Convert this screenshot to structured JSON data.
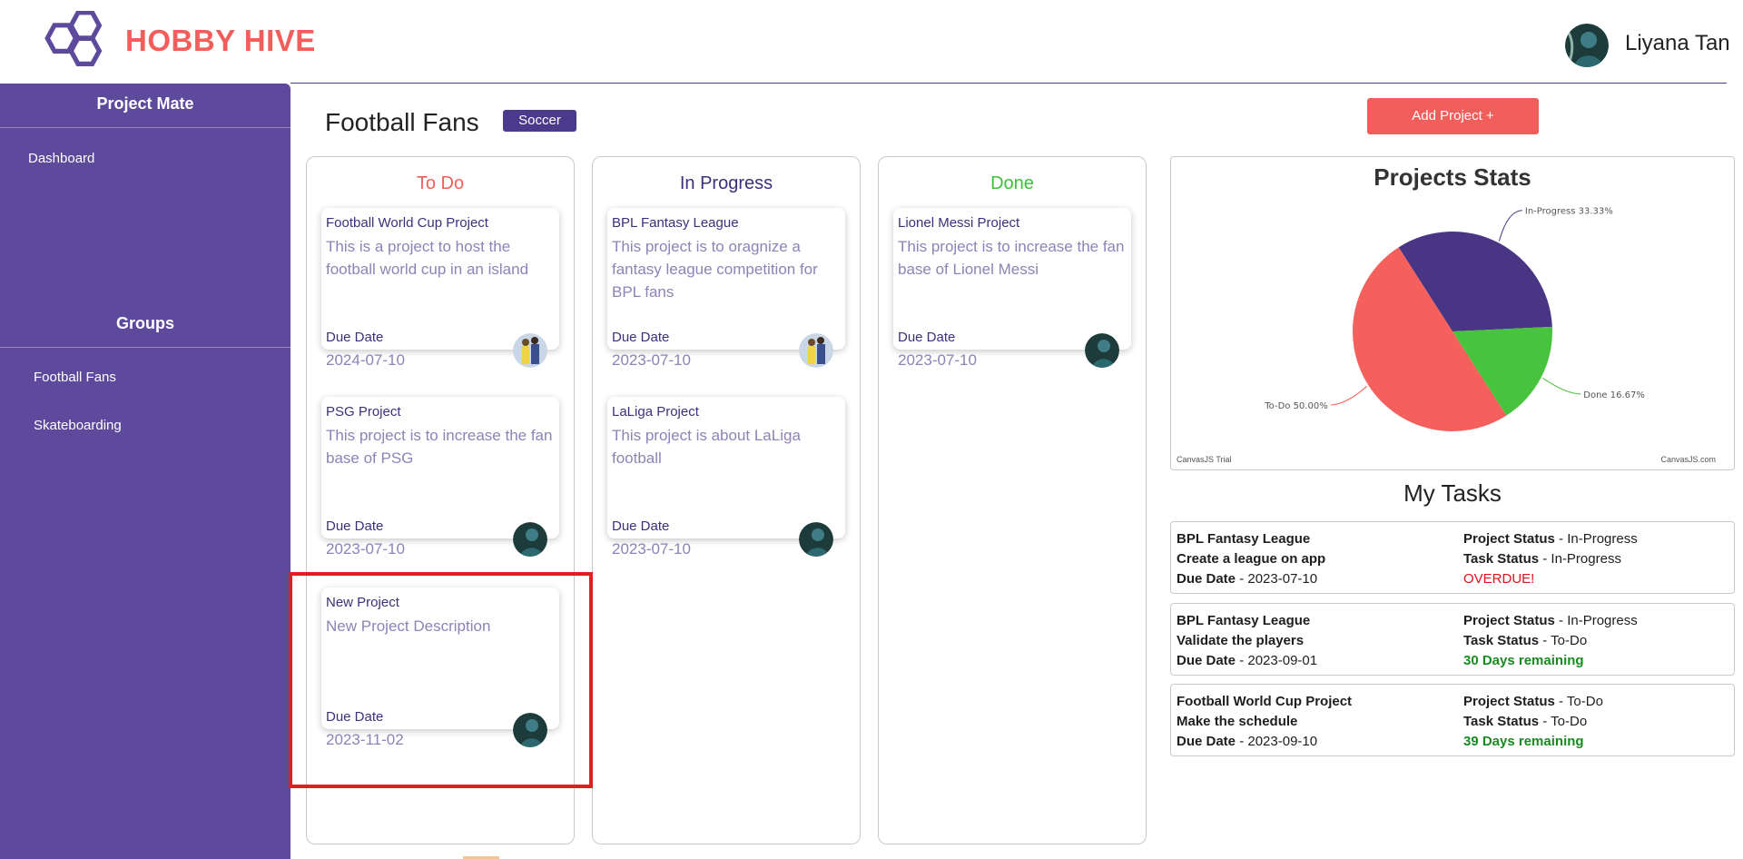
{
  "app": {
    "brand": "HOBBY HIVE",
    "user_name": "Liyana Tan",
    "colors": {
      "brand": "#f25e5b",
      "sidebar": "#5e4a9c",
      "accent": "#4b3a8c",
      "done": "#3cbf3a",
      "todo": "#f25e5b"
    }
  },
  "sidebar": {
    "title": "Project Mate",
    "nav": [
      {
        "label": "Dashboard"
      }
    ],
    "groups_title": "Groups",
    "groups": [
      {
        "label": "Football Fans"
      },
      {
        "label": "Skateboarding"
      }
    ]
  },
  "main": {
    "group_title": "Football Fans",
    "tag": "Soccer",
    "add_button": "Add Project +"
  },
  "board": {
    "due_label": "Due Date",
    "columns": [
      {
        "title": "To Do",
        "cards": [
          {
            "title": "Football World Cup Project",
            "description": "This is a project to host the football world cup in an island",
            "due": "2024-07-10",
            "avatar": "avatar-2"
          },
          {
            "title": "PSG Project",
            "description": "This project is to increase the fan base of PSG",
            "due": "2023-07-10",
            "avatar": "avatar-1"
          },
          {
            "title": "New Project",
            "description": "New Project Description",
            "due": "2023-11-02",
            "avatar": "avatar-1"
          }
        ]
      },
      {
        "title": "In Progress",
        "cards": [
          {
            "title": "BPL Fantasy League",
            "description": "This project is to oragnize a fantasy league competition for BPL fans",
            "due": "2023-07-10",
            "avatar": "avatar-2"
          },
          {
            "title": "LaLiga Project",
            "description": "This project is about LaLiga football",
            "due": "2023-07-10",
            "avatar": "avatar-1"
          }
        ]
      },
      {
        "title": "Done",
        "cards": [
          {
            "title": "Lionel Messi Project",
            "description": "This project is to increase the fan base of Lionel Messi",
            "due": "2023-07-10",
            "avatar": "avatar-1"
          }
        ]
      }
    ]
  },
  "stats": {
    "title": "Projects Stats",
    "watermark_left": "CanvasJS Trial",
    "watermark_right": "CanvasJS.com"
  },
  "chart_data": {
    "type": "pie",
    "title": "Projects Stats",
    "slices": [
      {
        "label": "In-Progress",
        "value": 33.33,
        "display": "In-Progress 33.33%",
        "color": "#483584"
      },
      {
        "label": "Done",
        "value": 16.67,
        "display": "Done 16.67%",
        "color": "#48c33e"
      },
      {
        "label": "To-Do",
        "value": 50.0,
        "display": "To-Do 50.00%",
        "color": "#f5605c"
      }
    ]
  },
  "tasks": {
    "title": "My Tasks",
    "labels": {
      "due": "Due Date",
      "project_status": "Project Status",
      "task_status": "Task Status"
    },
    "items": [
      {
        "project": "BPL Fantasy League",
        "task": "Create a league on app",
        "due": " - 2023-07-10",
        "project_status": " - In-Progress",
        "task_status": " - In-Progress",
        "note": "OVERDUE!",
        "note_type": "overdue"
      },
      {
        "project": "BPL Fantasy League",
        "task": "Validate the players",
        "due": " - 2023-09-01",
        "project_status": " - In-Progress",
        "task_status": " - To-Do",
        "note": "30 Days remaining",
        "note_type": "remaining"
      },
      {
        "project": "Football World Cup Project",
        "task": "Make the schedule",
        "due": " - 2023-09-10",
        "project_status": " - To-Do",
        "task_status": " - To-Do",
        "note": "39 Days remaining",
        "note_type": "remaining"
      }
    ]
  }
}
